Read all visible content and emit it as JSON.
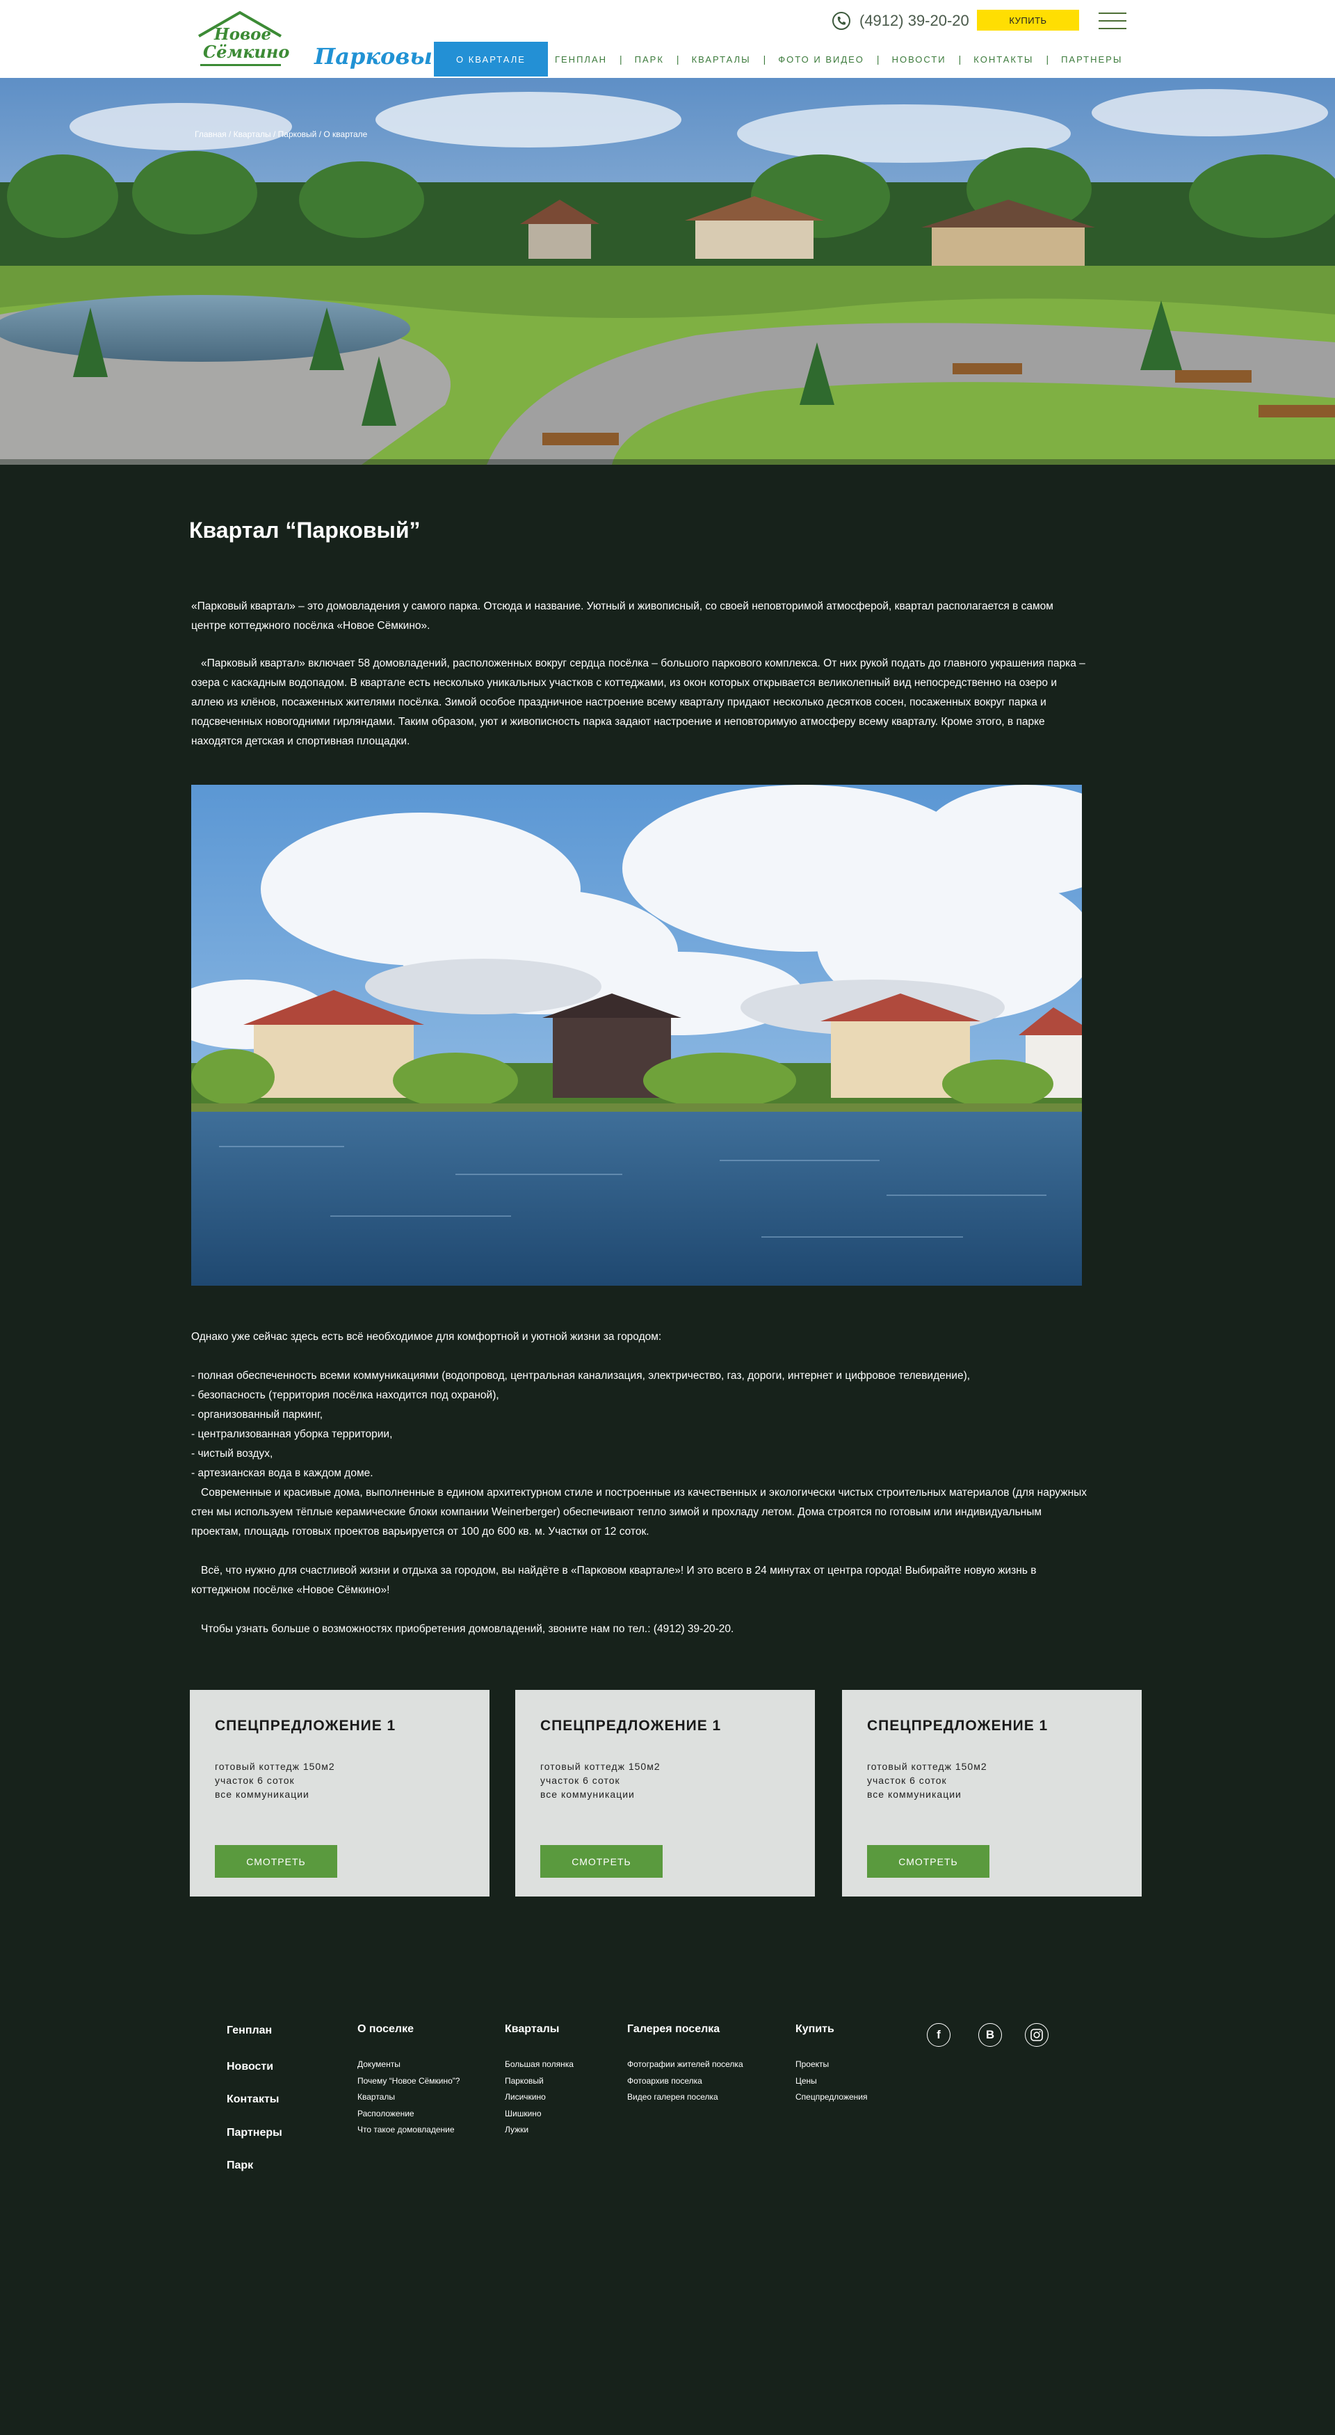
{
  "header": {
    "logo_line1": "Новое",
    "logo_line2": "Сёмкино",
    "brand": "Парковый",
    "phone": "(4912) 39-20-20",
    "buy_label": "КУПИТЬ",
    "nav": [
      {
        "label": "О КВАРТАЛЕ",
        "active": true
      },
      {
        "label": "ГЕНПЛАН"
      },
      {
        "label": "ПАРК"
      },
      {
        "label": "КВАРТАЛЫ"
      },
      {
        "label": "ФОТО И ВИДЕО"
      },
      {
        "label": "НОВОСТИ"
      },
      {
        "label": "КОНТАКТЫ"
      },
      {
        "label": "ПАРТНЕРЫ"
      }
    ]
  },
  "breadcrumb": "Главная / Кварталы / Парковый / О квартале",
  "main": {
    "title": "Квартал “Парковый”",
    "p1": "«Парковый квартал» – это домовладения у самого парка. Отсюда и название. Уютный и живописный, со своей неповторимой атмосферой, квартал располагается в самом центре коттеджного посёлка «Новое Сёмкино».",
    "p2": "«Парковый квартал» включает 58 домовладений, расположенных вокруг сердца посёлка – большого паркового комплекса. От них рукой подать до главного украшения парка – озера с каскадным водопадом. В квартале есть несколько уникальных участков с коттеджами, из окон которых открывается великолепный вид непосредственно на озеро и аллею из клёнов, посаженных жителями посёлка. Зимой особое праздничное настроение всему кварталу придают несколько десятков сосен, посаженных вокруг парка и подсвеченных новогодними гирляндами. Таким образом, уют и живописность парка задают настроение и неповторимую атмосферу всему кварталу. Кроме этого, в парке находятся детская и спортивная площадки.",
    "intro": "Однако уже сейчас здесь есть всё необходимое для комфортной и уютной жизни за городом:",
    "list": [
      " - полная обеспеченность всеми коммуникациями (водопровод, центральная канализация, электричество, газ, дороги, интернет и цифровое телевидение),",
      " - безопасность (территория посёлка находится под охраной),",
      " - организованный паркинг,",
      " - централизованная уборка территории,",
      " - чистый воздух,",
      " - артезианская вода в каждом доме."
    ],
    "p3": "Современные и красивые дома, выполненные в едином архитектурном стиле и построенные из качественных и экологически чистых строительных материалов (для наружных стен мы используем тёплые керамические блоки компании Weinerberger) обеспечивают тепло зимой и прохладу летом. Дома строятся по готовым или индивидуальным проектам, площадь готовых проектов варьируется от 100 до 600 кв. м. Участки от 12 соток.",
    "p4": "Всё, что нужно для счастливой жизни и отдыха за городом, вы найдёте в «Парковом квартале»!  И это всего в 24 минутах от центра города! Выбирайте новую жизнь в коттеджном посёлке «Новое Сёмкино»!",
    "p5": "Чтобы узнать больше о возможностях приобретения домовладений, звоните нам по тел.: (4912) 39-20-20."
  },
  "offers": [
    {
      "title": "СПЕЦПРЕДЛОЖЕНИЕ 1",
      "line1": "готовый коттедж 150м2",
      "line2": "участок 6 соток",
      "line3": "все коммуникации",
      "button": "СМОТРЕТЬ"
    },
    {
      "title": "СПЕЦПРЕДЛОЖЕНИЕ 1",
      "line1": "готовый коттедж 150м2",
      "line2": "участок 6 соток",
      "line3": "все коммуникации",
      "button": "СМОТРЕТЬ"
    },
    {
      "title": "СПЕЦПРЕДЛОЖЕНИЕ 1",
      "line1": "готовый коттедж 150м2",
      "line2": "участок 6 соток",
      "line3": "все коммуникации",
      "button": "СМОТРЕТЬ"
    }
  ],
  "footer": {
    "main_links": [
      "Генплан",
      "Новости",
      "Контакты",
      "Партнеры",
      "Парк"
    ],
    "columns": [
      {
        "title": "О поселке",
        "links": [
          "Документы",
          "Почему “Новое Сёмкино”?",
          "Кварталы",
          "Расположение",
          "Что такое домовладение"
        ]
      },
      {
        "title": "Кварталы",
        "links": [
          "Большая полянка",
          "Парковый",
          "Лисичкино",
          "Шишкино",
          "Лужки"
        ]
      },
      {
        "title": "Галерея поселка",
        "links": [
          "Фотографии жителей поселка",
          "Фотоархив поселка",
          "Видео галерея поселка"
        ]
      },
      {
        "title": "Купить",
        "links": [
          "Проекты",
          "Цены",
          "Спецпредложения"
        ]
      }
    ],
    "social": [
      {
        "icon": "facebook-icon",
        "glyph": "f"
      },
      {
        "icon": "vk-icon",
        "glyph": "В"
      },
      {
        "icon": "instagram-icon",
        "glyph": ""
      }
    ]
  },
  "colors": {
    "background": "#17221b",
    "accent_blue": "#2390d5",
    "buy_yellow": "#ffde02",
    "button_green": "#5a9a3e",
    "offer_card": "#dde0de"
  }
}
